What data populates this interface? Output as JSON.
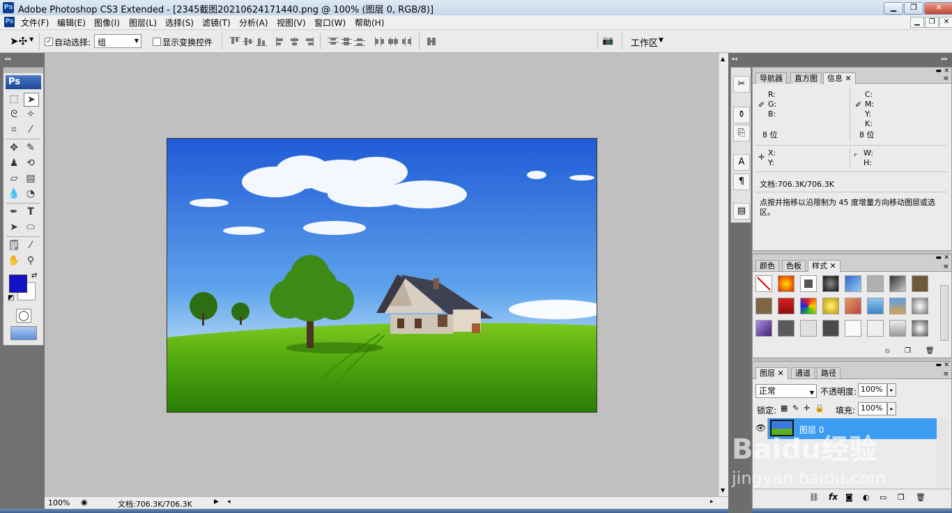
{
  "window": {
    "title": "Adobe Photoshop CS3 Extended - [2345截图20210624171440.png @ 100% (图层 0, RGB/8)]",
    "app_badge": "Ps"
  },
  "menu": [
    "文件(F)",
    "编辑(E)",
    "图像(I)",
    "图层(L)",
    "选择(S)",
    "滤镜(T)",
    "分析(A)",
    "视图(V)",
    "窗口(W)",
    "帮助(H)"
  ],
  "options": {
    "auto_select_label": "自动选择:",
    "auto_select_value": "组",
    "show_transform_label": "显示变换控件",
    "workspace_label": "工作区"
  },
  "toolbox": {
    "logo": "Ps"
  },
  "status": {
    "zoom": "100%",
    "doc": "文档:706.3K/706.3K"
  },
  "info_panel": {
    "tabs": [
      "导航器",
      "直方图",
      "信息"
    ],
    "rgb_labels": [
      "R:",
      "G:",
      "B:"
    ],
    "cmyk_labels": [
      "C:",
      "M:",
      "Y:",
      "K:"
    ],
    "bits_left": "8 位",
    "bits_right": "8 位",
    "xy_labels": [
      "X:",
      "Y:"
    ],
    "wh_labels": [
      "W:",
      "H:"
    ],
    "doc": "文档:706.3K/706.3K",
    "hint": "点按并拖移以沿限制为 45 度增量方向移动图层或选区。"
  },
  "styles_panel": {
    "tabs": [
      "颜色",
      "色板",
      "样式"
    ]
  },
  "layers_panel": {
    "tabs": [
      "图层",
      "通道",
      "路径"
    ],
    "blend_mode": "正常",
    "opacity_label": "不透明度:",
    "opacity": "100%",
    "lock_label": "锁定:",
    "fill_label": "填充:",
    "fill": "100%",
    "layer_name": "图层 0"
  },
  "watermark": {
    "logo": "Baidu经验",
    "url": "jingyan.baidu.com"
  },
  "colors": {
    "foreground": "#1212c8",
    "background": "#ffffff",
    "selected_layer": "#3c9cf2"
  }
}
